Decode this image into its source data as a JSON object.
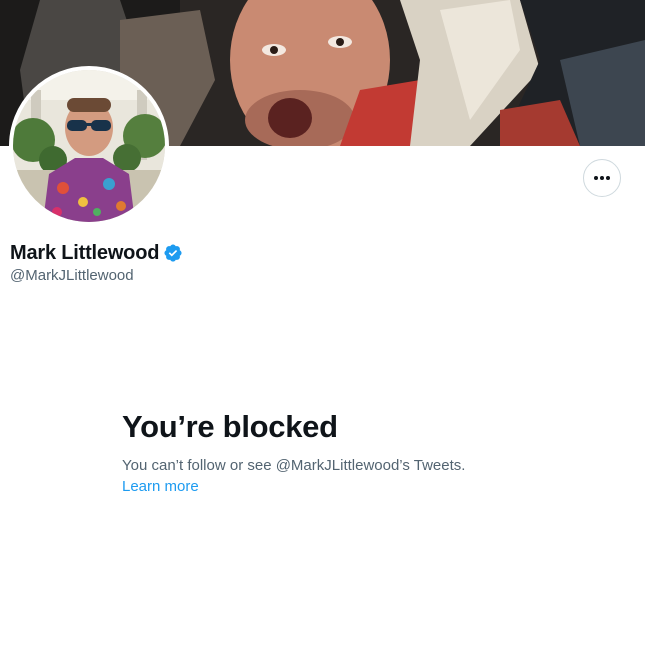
{
  "profile": {
    "display_name": "Mark Littlewood",
    "handle": "@MarkJLittlewood",
    "verified": true,
    "banner_image": "photo-crowd-shouting-man",
    "avatar_image": "photo-man-sunglasses-palm-trees"
  },
  "actions": {
    "more_icon": "more-horizontal-icon"
  },
  "blocked": {
    "title": "You’re blocked",
    "message": "You can’t follow or see @MarkJLittlewood’s Tweets.",
    "link": "Learn more"
  },
  "colors": {
    "accent": "#1d9bf0",
    "text_primary": "#0f1419",
    "text_secondary": "#536471",
    "border": "#cfd9de"
  }
}
